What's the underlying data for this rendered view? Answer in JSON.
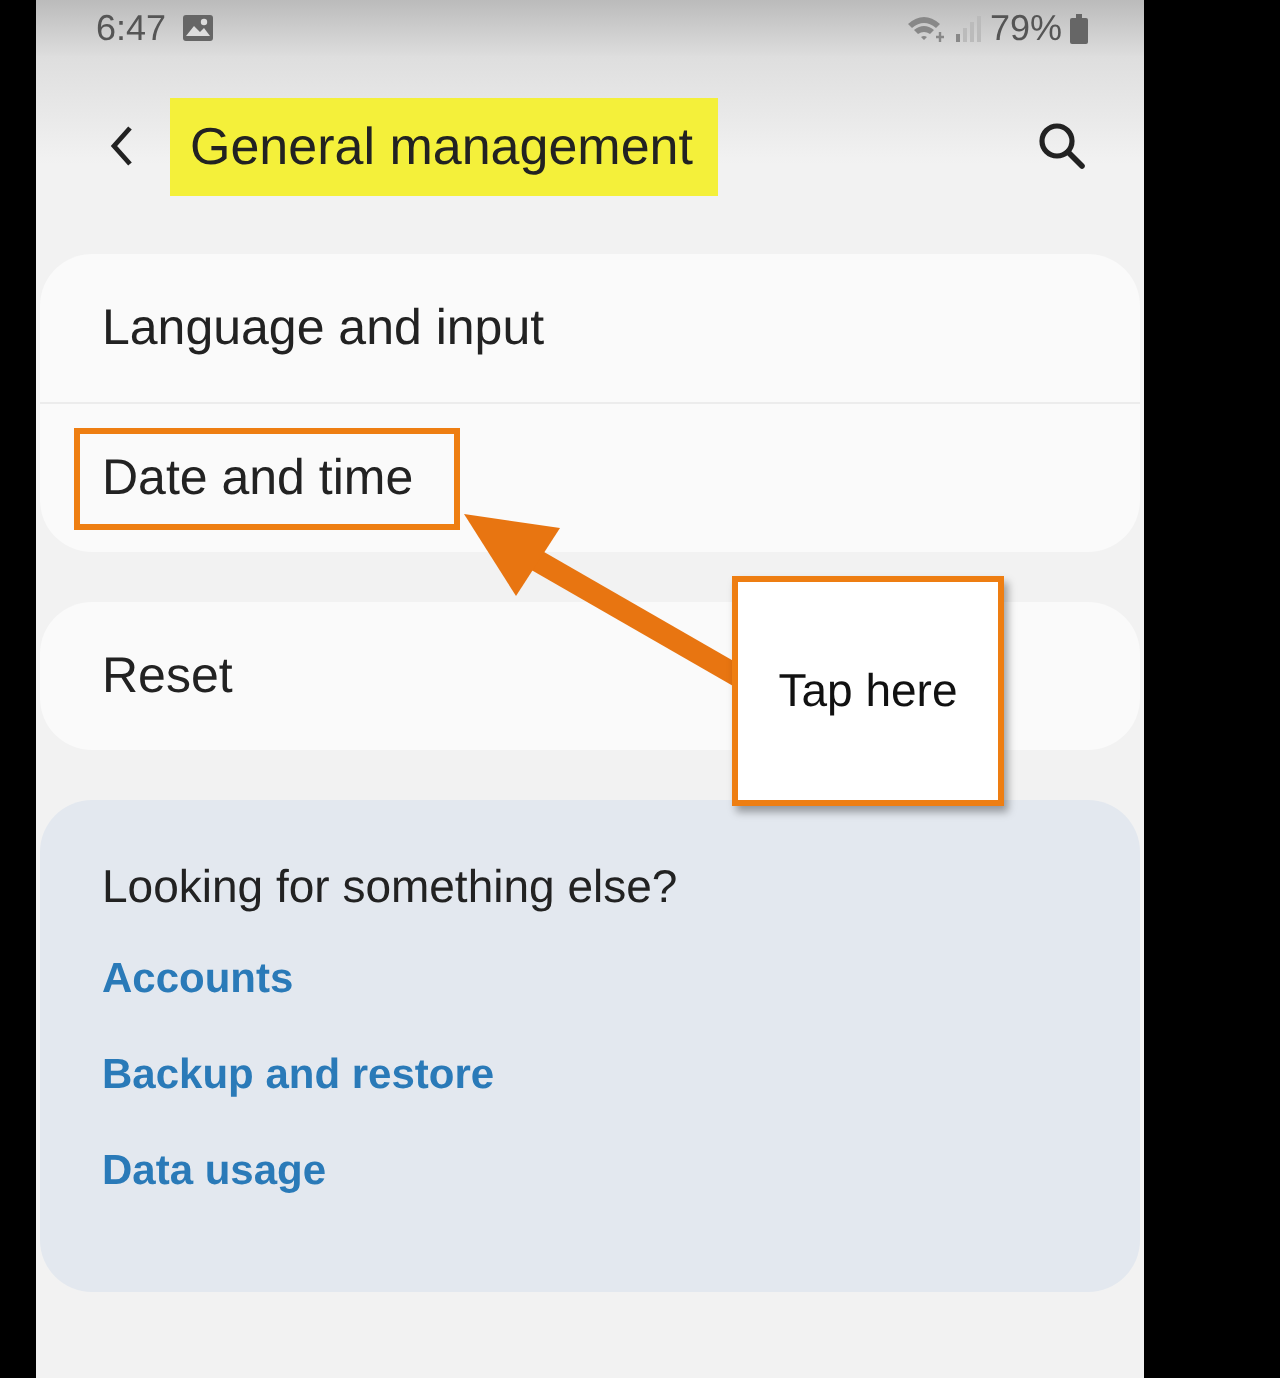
{
  "status_bar": {
    "time": "6:47",
    "battery": "79%"
  },
  "header": {
    "title": "General management",
    "highlighted": true
  },
  "groups": [
    {
      "items": [
        {
          "label": "Language and input",
          "outlined": false
        },
        {
          "label": "Date and time",
          "outlined": true
        }
      ]
    },
    {
      "items": [
        {
          "label": "Reset",
          "outlined": false
        }
      ]
    }
  ],
  "suggestions": {
    "heading": "Looking for something else?",
    "links": [
      "Accounts",
      "Backup and restore",
      "Data usage"
    ]
  },
  "callout": {
    "text": "Tap here"
  }
}
